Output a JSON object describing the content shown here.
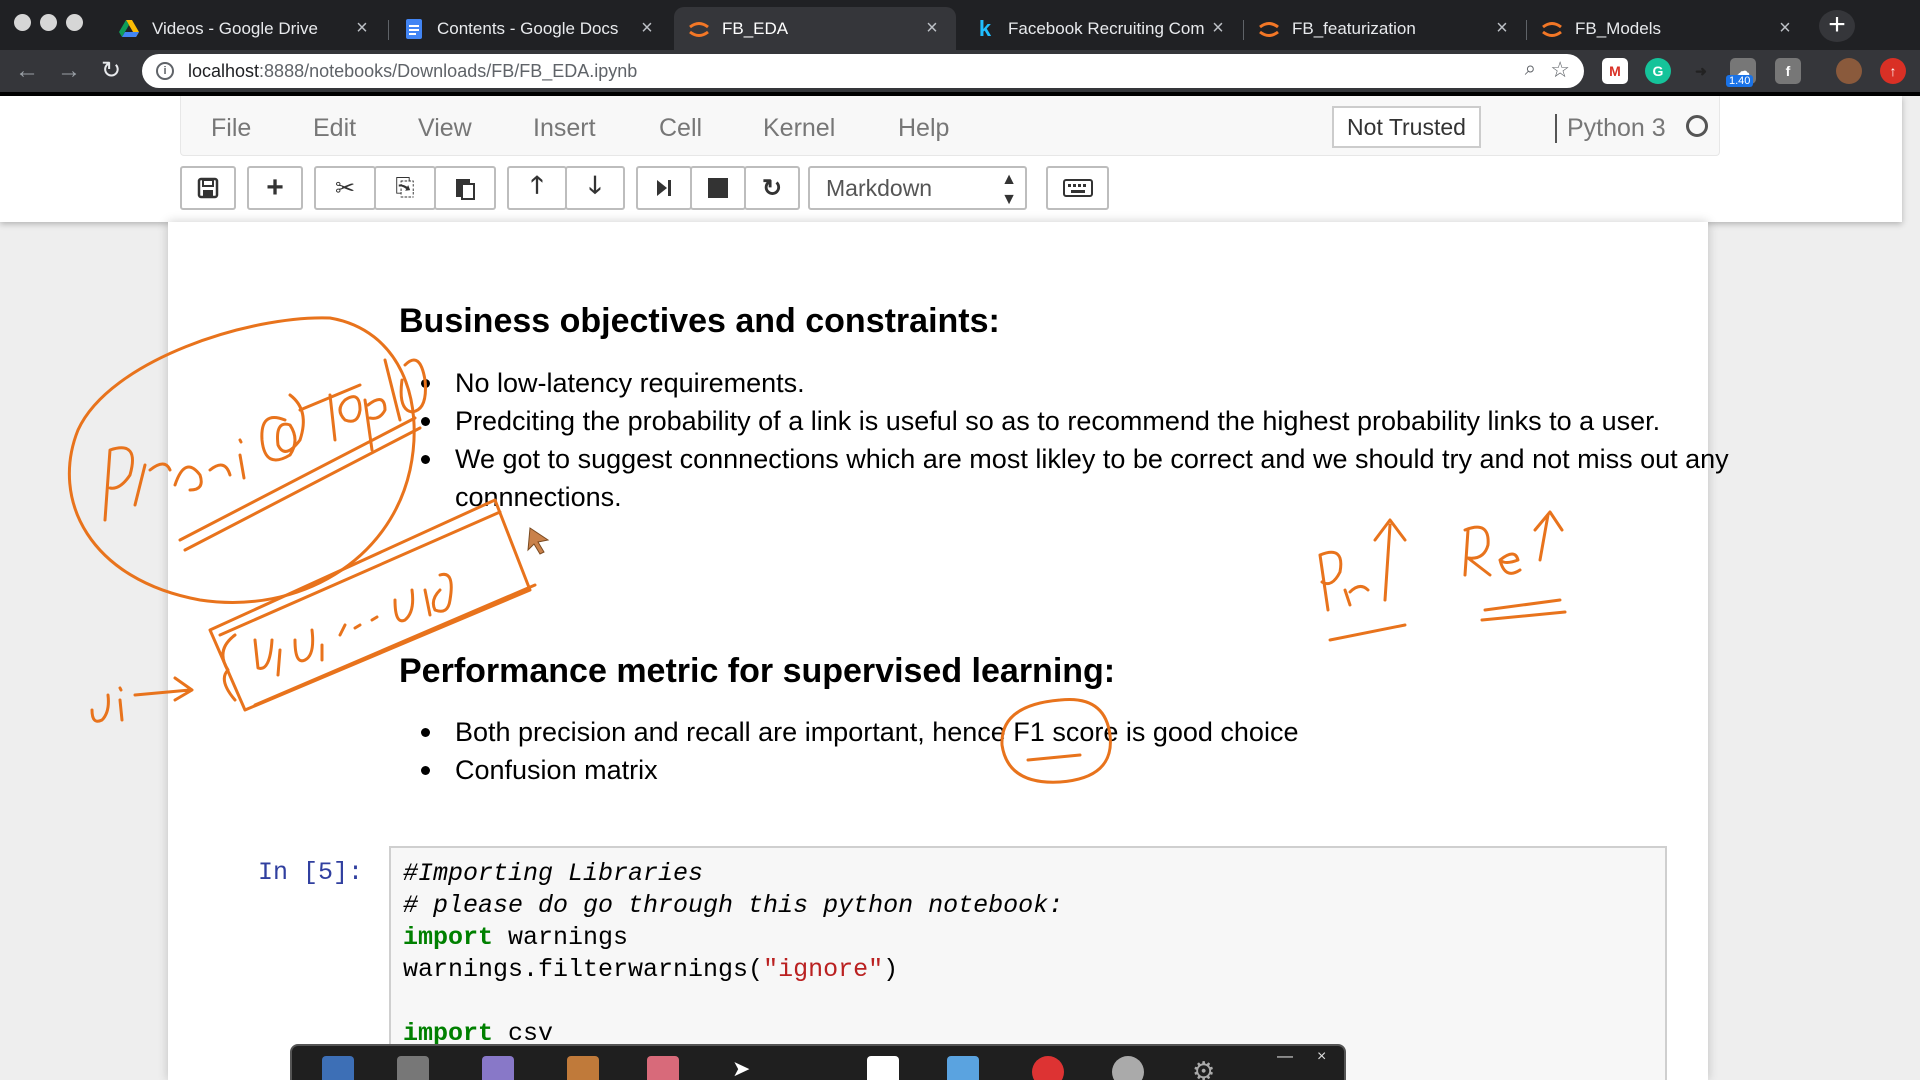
{
  "browser": {
    "tabs": [
      {
        "title": "Videos - Google Drive",
        "icon": "google-drive-icon",
        "active": false
      },
      {
        "title": "Contents - Google Docs",
        "icon": "google-docs-icon",
        "active": false
      },
      {
        "title": "FB_EDA",
        "icon": "jupyter-icon",
        "active": true
      },
      {
        "title": "Facebook Recruiting Com",
        "icon": "kaggle-icon",
        "active": false
      },
      {
        "title": "FB_featurization",
        "icon": "jupyter-icon",
        "active": false
      },
      {
        "title": "FB_Models",
        "icon": "jupyter-icon",
        "active": false
      }
    ],
    "url_host": "localhost",
    "url_path": ":8888/notebooks/Downloads/FB/FB_EDA.ipynb",
    "extension_badge": "1.40"
  },
  "jupyter": {
    "menu": [
      "File",
      "Edit",
      "View",
      "Insert",
      "Cell",
      "Kernel",
      "Help"
    ],
    "trust_label": "Not Trusted",
    "kernel_name": "Python 3",
    "cell_type": "Markdown"
  },
  "notebook": {
    "section1": {
      "heading": "Business objectives and constraints:",
      "bullets": [
        "No low-latency requirements.",
        "Predciting the probability of a link is useful so as to recommend the highest probability links to a user.",
        "We got to suggest connnections which are most likley to be correct and we should try and not miss out any connnections."
      ]
    },
    "section2": {
      "heading": "Performance metric for supervised learning:",
      "bullets": [
        "Both precision and recall are important, hence F1 score is good choice",
        "Confusion matrix"
      ]
    },
    "code_cell": {
      "prompt": "In [5]:",
      "comment1": "#Importing Libraries",
      "comment2": "# please do go through this python notebook:",
      "kw_import": "import",
      "mod_warnings": " warnings",
      "call_prefix": "warnings.filterwarnings(",
      "call_arg": "\"ignore\"",
      "call_suffix": ")",
      "mod_csv": " csv"
    }
  },
  "annotations": {
    "color": "#e8731c",
    "ink_color_hint": "orange handwriting",
    "text1": "Preci@top10",
    "text2": "ui",
    "text3": "{u1,u2,...u10}",
    "text4": "Pr↑",
    "text5": "Re↑"
  },
  "colors": {
    "accent": "#e8731c",
    "prompt": "#303f9f",
    "keyword": "#008000",
    "string": "#ba2121",
    "comment": "#408080"
  }
}
